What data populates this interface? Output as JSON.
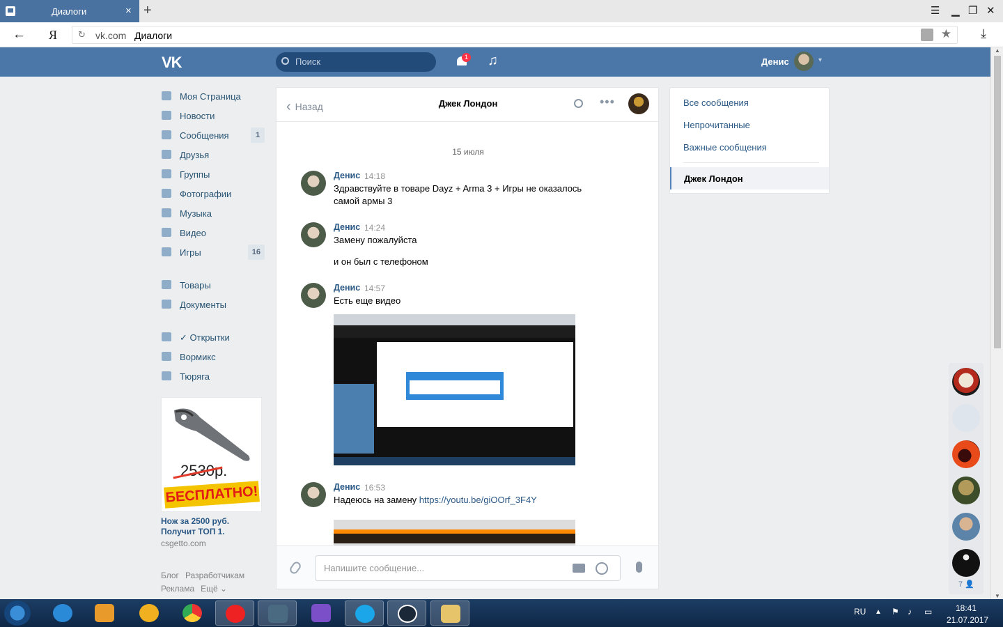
{
  "browser": {
    "tab_title": "Диалоги",
    "tab_close": "×",
    "new_tab": "+",
    "url_host": "vk.com",
    "url_path": "Диалоги",
    "yandex_letter": "Я",
    "back_arrow": "←",
    "reload": "↻",
    "star": "★",
    "download": "⤓",
    "menu_icon": "☰",
    "min_icon": "▁",
    "restore_icon": "❐",
    "close_icon": "✕"
  },
  "header": {
    "logo": "VK",
    "search_placeholder": "Поиск",
    "notification_count": "1",
    "music_icon": "♫",
    "user_name": "Денис",
    "caret": "▾"
  },
  "menu": {
    "items": [
      {
        "label": "Моя Страница",
        "badge": ""
      },
      {
        "label": "Новости",
        "badge": ""
      },
      {
        "label": "Сообщения",
        "badge": "1"
      },
      {
        "label": "Друзья",
        "badge": ""
      },
      {
        "label": "Группы",
        "badge": ""
      },
      {
        "label": "Фотографии",
        "badge": ""
      },
      {
        "label": "Музыка",
        "badge": ""
      },
      {
        "label": "Видео",
        "badge": ""
      },
      {
        "label": "Игры",
        "badge": "16"
      },
      {
        "label": "Товары",
        "badge": ""
      },
      {
        "label": "Документы",
        "badge": ""
      },
      {
        "label": "✓ Открытки",
        "badge": ""
      },
      {
        "label": "Вормикс",
        "badge": ""
      },
      {
        "label": "Тюряга",
        "badge": ""
      }
    ]
  },
  "ad": {
    "old_price": "2530р.",
    "free_label": "БЕСПЛАТНО!",
    "title": "Нож за 2500 руб. Получит ТОП 1.",
    "domain": "csgetto.com"
  },
  "footer": {
    "blog": "Блог",
    "developers": "Разработчикам",
    "ads": "Реклама",
    "more": "Ещё ⌄"
  },
  "chat": {
    "back": "Назад",
    "back_chevron": "‹",
    "title": "Джек Лондон",
    "dots": "•••",
    "date": "15 июля",
    "messages": [
      {
        "author": "Денис",
        "time": "14:18",
        "text": "Здравствуйте в товаре Dayz + Arma 3 + Игры не оказалось самой армы 3"
      },
      {
        "author": "Денис",
        "time": "14:24",
        "text": "Замену пожалуйста",
        "text2": "и он был с телефоном"
      },
      {
        "author": "Денис",
        "time": "14:57",
        "text": "Есть еще видео"
      },
      {
        "author": "Денис",
        "time": "16:53",
        "text": "Надеюсь на замену ",
        "link": "https://youtu.be/giOOrf_3F4Y"
      }
    ],
    "composer_placeholder": "Напишите сообщение..."
  },
  "filters": {
    "all": "Все сообщения",
    "unread": "Непрочитанные",
    "important": "Важные сообщения",
    "selected": "Джек Лондон"
  },
  "friends": {
    "count": "7 👤"
  },
  "taskbar": {
    "lang": "RU",
    "time": "18:41",
    "date": "21.07.2017"
  }
}
